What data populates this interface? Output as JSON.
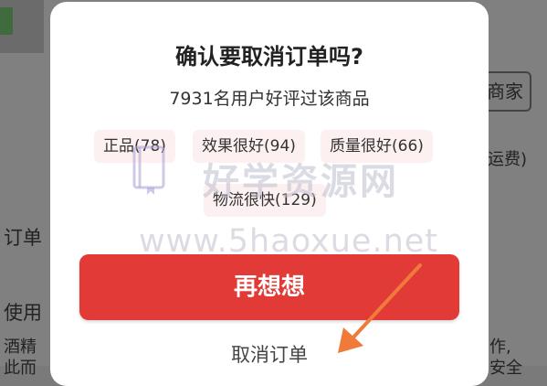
{
  "background": {
    "merchant_button": "商家",
    "shipping_fee": "运费)",
    "order_label": "订单",
    "use_label": "使用",
    "line1_left": "酒精",
    "line2_left": "此而",
    "line1_right": "作,",
    "line2_right": "安全"
  },
  "dialog": {
    "title": "确认要取消订单吗?",
    "subtitle": "7931名用户好评过该商品",
    "tags": [
      "正品(78)",
      "效果很好(94)",
      "质量很好(66)",
      "物流很快(129)"
    ],
    "primary_button": "再想想",
    "cancel_order_link": "取消订单"
  },
  "watermark": {
    "title": "好学资源网",
    "url": "www.5haoxue.net"
  },
  "colors": {
    "primary": "#e23a36",
    "tag_background": "#fdf0f0",
    "arrow": "#f07a3a"
  }
}
